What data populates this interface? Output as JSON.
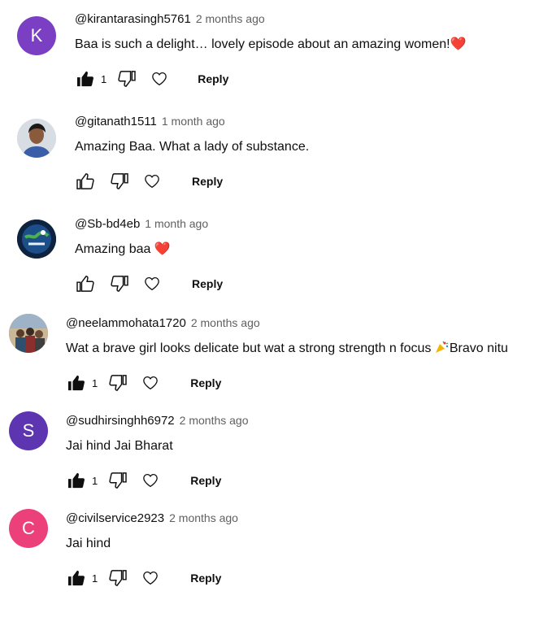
{
  "comments": [
    {
      "author": "@kirantarasingh5761",
      "time": "2 months ago",
      "text": "Baa is such a delight… lovely episode about an amazing women!",
      "emoji": "❤️",
      "likes": "1",
      "avatar_letter": "K",
      "avatar_color": "#7b3fc4",
      "reply": "Reply"
    },
    {
      "author": "@gitanath1511",
      "time": "1 month ago",
      "text": "Amazing Baa. What a lady of substance.",
      "emoji": "",
      "likes": "",
      "avatar_letter": "",
      "avatar_color": "#cfd6df",
      "reply": "Reply"
    },
    {
      "author": "@Sb-bd4eb",
      "time": "1 month ago",
      "text": "Amazing baa",
      "emoji": "❤️",
      "likes": "",
      "avatar_letter": "",
      "avatar_color": "#0d2340",
      "reply": "Reply"
    },
    {
      "author": "@neelammohata1720",
      "time": "2 months ago",
      "text": "Wat a brave girl looks delicate but wat a strong strength n focus",
      "emoji_after": "Bravo nitu",
      "likes": "1",
      "avatar_letter": "",
      "avatar_color": "#8a7a68",
      "reply": "Reply"
    },
    {
      "author": "@sudhirsinghh6972",
      "time": "2 months ago",
      "text": "Jai hind Jai Bharat",
      "emoji": "",
      "likes": "1",
      "avatar_letter": "S",
      "avatar_color": "#5e35b1",
      "reply": "Reply"
    },
    {
      "author": "@civilservice2923",
      "time": "2 months ago",
      "text": "Jai hind",
      "emoji": "",
      "likes": "1",
      "avatar_letter": "C",
      "avatar_color": "#ec407a",
      "reply": "Reply"
    }
  ]
}
